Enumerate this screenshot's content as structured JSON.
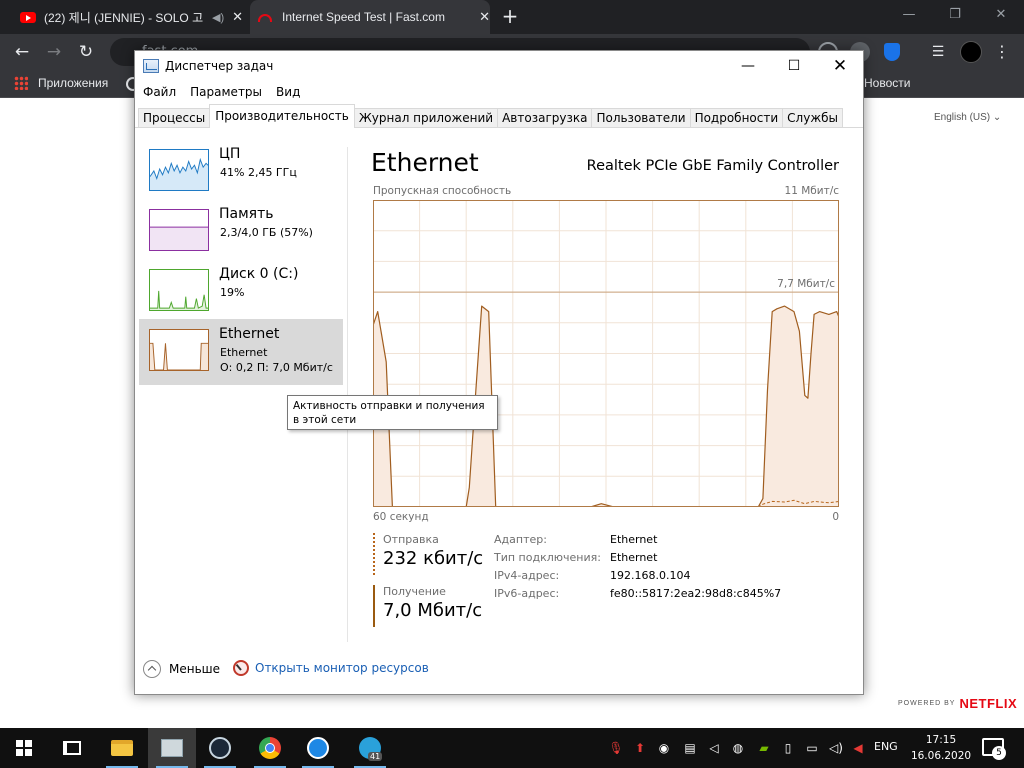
{
  "chrome": {
    "tabs": [
      {
        "title": "(22) 제니 (JENNIE) - SOLO 고",
        "active": false
      },
      {
        "title": "Internet Speed Test | Fast.com",
        "active": true
      }
    ],
    "new_tab": "+",
    "omnibox_url": "fast.com",
    "bookmarks": {
      "apps_label": "Приложения",
      "news_label": "Новости"
    },
    "window_controls": {
      "minimize": "—",
      "maximize": "❐",
      "close": "✕"
    }
  },
  "fast_page": {
    "language": "English (US) ⌄",
    "powered_by": "POWERED BY",
    "netflix": "NETFLIX"
  },
  "taskmgr": {
    "title": "Диспетчер задач",
    "window_controls": {
      "minimize": "—",
      "maximize": "☐",
      "close": "✕"
    },
    "menu": [
      "Файл",
      "Параметры",
      "Вид"
    ],
    "tabs": [
      "Процессы",
      "Производительность",
      "Журнал приложений",
      "Автозагрузка",
      "Пользователи",
      "Подробности",
      "Службы"
    ],
    "active_tab": "Производительность",
    "tiles": {
      "cpu": {
        "name": "ЦП",
        "sub": "41% 2,45 ГГц",
        "color": "#1f7ac4"
      },
      "memory": {
        "name": "Память",
        "sub": "2,3/4,0 ГБ (57%)",
        "color": "#8b2fa0"
      },
      "disk": {
        "name": "Диск 0 (C:)",
        "sub": "19%",
        "color": "#4ea72e"
      },
      "ethernet": {
        "name": "Ethernet",
        "sub1": "Ethernet",
        "sub2": "О: 0,2 П: 7,0 Мбит/с",
        "color": "#a7632a"
      }
    },
    "tooltip": "Активность отправки и получения в этой сети",
    "detail": {
      "title": "Ethernet",
      "adapter": "Realtek PCIe GbE Family Controller",
      "throughput_label": "Пропускная способность",
      "max_label": "11 Мбит/с",
      "scale_line_label": "7,7 Мбит/с",
      "x_left": "60 секунд",
      "x_right": "0"
    },
    "chart_data": {
      "type": "area",
      "title": "",
      "xlabel": "",
      "ylabel": "Пропускная способность",
      "x_unit": "seconds ago",
      "y_unit": "Мбит/с",
      "xlim": [
        60,
        0
      ],
      "ylim": [
        0,
        11
      ],
      "grid": true,
      "reference_line": 7.7,
      "series": [
        {
          "name": "Получение",
          "style": "solid",
          "x": [
            60,
            59.4,
            58.3,
            57.5,
            56.7,
            55.5,
            54,
            52,
            50,
            48,
            47.6,
            46.8,
            46,
            45.1,
            44.2,
            43.4,
            42,
            38,
            34,
            32,
            30.6,
            29,
            26,
            22,
            18,
            14,
            10.4,
            9.8,
            9.2,
            8.6,
            8.0,
            7.0,
            5.8,
            5.1,
            4.4,
            4.0,
            3.6,
            3.2,
            2.5,
            1.3,
            0.3,
            0
          ],
          "y": [
            6.5,
            7.0,
            5.2,
            0,
            0,
            0,
            0,
            0,
            0,
            0,
            0.7,
            4.0,
            7.2,
            7.0,
            0,
            0,
            0,
            0,
            0,
            0,
            0.12,
            0,
            0,
            0,
            0,
            0,
            0,
            0.3,
            4.2,
            7.0,
            7.1,
            7.2,
            7.0,
            6.3,
            4.0,
            3.9,
            5.5,
            6.9,
            7.0,
            6.9,
            7.0,
            6.8
          ]
        },
        {
          "name": "Отправка",
          "style": "dashed",
          "x": [
            60,
            10.4,
            9.8,
            8.6,
            7.0,
            5.8,
            4.4,
            3.2,
            1.3,
            0
          ],
          "y": [
            0,
            0,
            0.1,
            0.2,
            0.18,
            0.24,
            0.12,
            0.2,
            0.15,
            0.2
          ]
        }
      ]
    },
    "stats": {
      "send_label": "Отправка",
      "send_value": "232 кбит/с",
      "recv_label": "Получение",
      "recv_value": "7,0 Мбит/с"
    },
    "properties": [
      {
        "key": "Адаптер:",
        "value": "Ethernet"
      },
      {
        "key": "Тип подключения:",
        "value": "Ethernet"
      },
      {
        "key": "IPv4-адрес:",
        "value": "192.168.0.104"
      },
      {
        "key": "IPv6-адрес:",
        "value": "fe80::5817:2ea2:98d8:c845%7"
      }
    ],
    "footer": {
      "fewer_label": "Меньше",
      "resmon_label": "Открыть монитор ресурсов"
    }
  },
  "taskbar": {
    "pinned": [
      "windows-start",
      "task-view",
      "file-explorer",
      "task-manager",
      "steam",
      "chrome",
      "support-client",
      "telegram"
    ],
    "telegram_badge": "41",
    "language": "ENG",
    "time": "17:15",
    "date": "16.06.2020",
    "notification_count": "5"
  }
}
